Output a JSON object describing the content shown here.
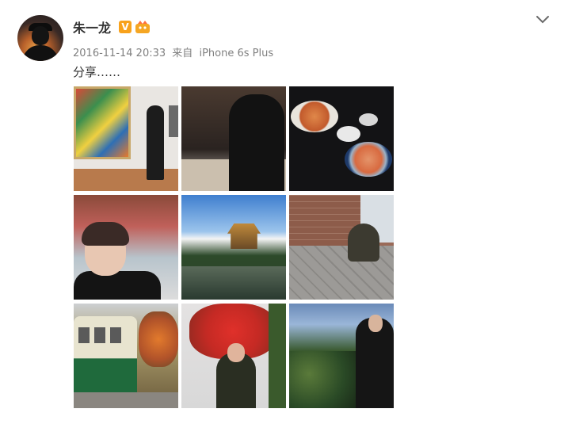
{
  "post": {
    "author": "朱一龙",
    "verified_badge": "V",
    "timestamp": "2016-11-14 20:33",
    "source_prefix": "来自",
    "device": "iPhone 6s Plus",
    "text": "分享……"
  },
  "icons": {
    "verified": "verified-v-icon",
    "member": "member-crown-icon",
    "menu": "chevron-down-icon"
  },
  "colors": {
    "verified_badge": "#f8a21c",
    "name_text": "#333333",
    "meta_text": "#808080"
  },
  "photos": [
    {
      "subject": "museum-photo"
    },
    {
      "subject": "restaurant-photo"
    },
    {
      "subject": "food-photo"
    },
    {
      "subject": "temple-selfie-photo"
    },
    {
      "subject": "golden-pavilion-photo"
    },
    {
      "subject": "alley-photo"
    },
    {
      "subject": "tram-photo"
    },
    {
      "subject": "autumn-leaves-photo"
    },
    {
      "subject": "valley-photo"
    }
  ]
}
